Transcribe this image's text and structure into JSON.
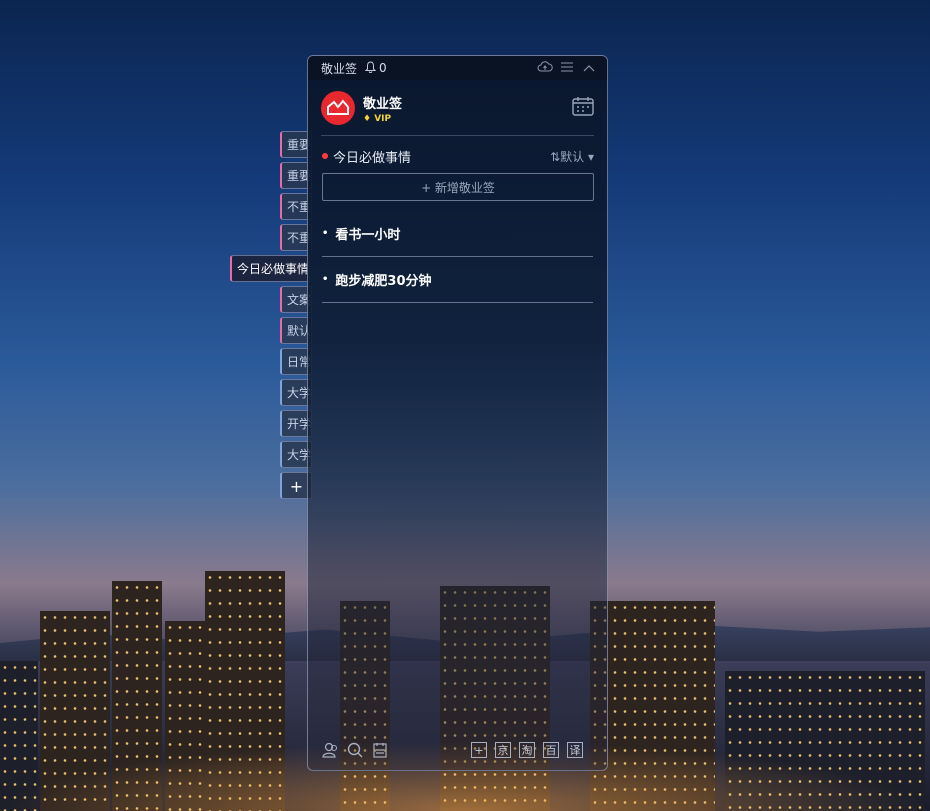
{
  "topbar": {
    "app_name": "敬业签",
    "notification_count": "0"
  },
  "header": {
    "brand_name": "敬业签",
    "vip_label": "VIP"
  },
  "list": {
    "title": "今日必做事情",
    "sort_label": "⇅默认 ▾",
    "add_button": "+ 新增敬业签"
  },
  "tasks": [
    {
      "text": "看书一小时"
    },
    {
      "text": "跑步减肥30分钟"
    }
  ],
  "side_tabs": [
    {
      "label": "重要"
    },
    {
      "label": "重要"
    },
    {
      "label": "不重"
    },
    {
      "label": "不重"
    },
    {
      "label": "今日必做事情"
    },
    {
      "label": "文案"
    },
    {
      "label": "默认"
    },
    {
      "label": "日常"
    },
    {
      "label": "大学"
    },
    {
      "label": "开学"
    },
    {
      "label": "大学"
    },
    {
      "label": "+"
    }
  ],
  "bottom_shortcuts": [
    "+",
    "京",
    "淘",
    "百",
    "译"
  ],
  "colors": {
    "accent_red": "#e8272e",
    "vip_gold": "#f2d33b",
    "tab_pink": "#e86aa8"
  }
}
